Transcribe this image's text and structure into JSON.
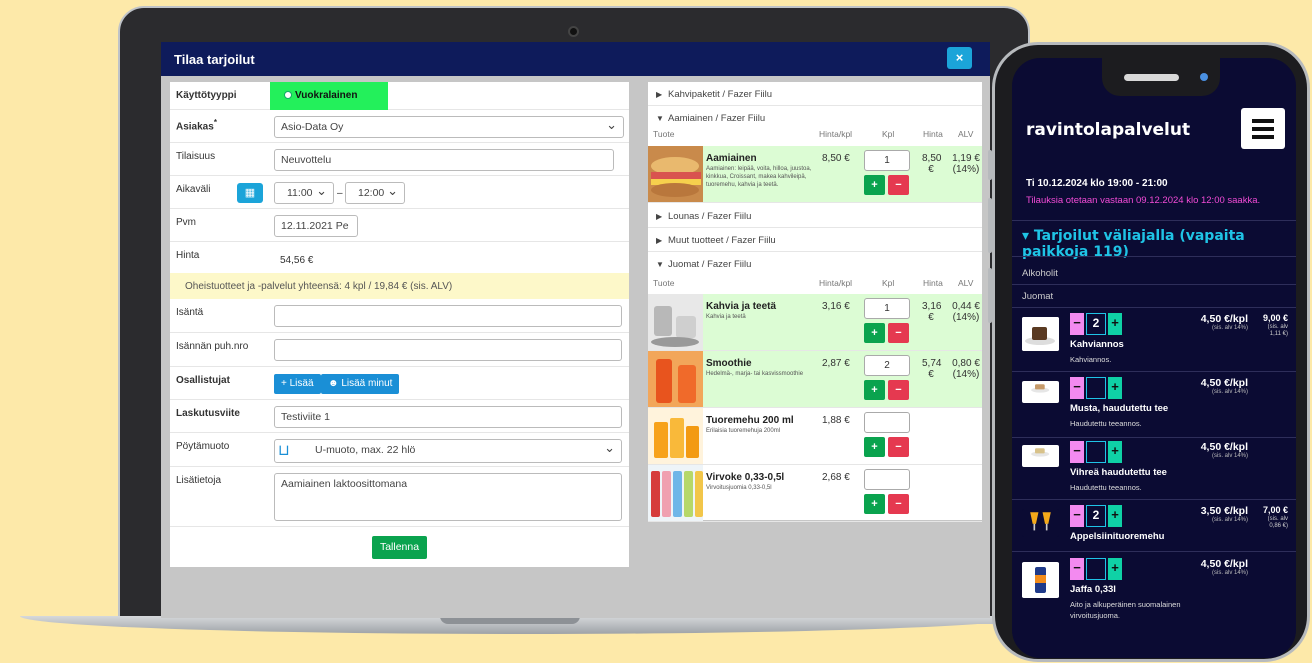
{
  "modal": {
    "title": "Tilaa tarjoilut",
    "close": "×"
  },
  "form": {
    "kayttotyyppi_label": "Käyttötyyppi",
    "kayttotyyppi_value": "Vuokralainen",
    "asiakas_label": "Asiakas",
    "asiakas_required": "*",
    "asiakas_value": "Asio-Data Oy",
    "tilaisuus_label": "Tilaisuus",
    "tilaisuus_value": "Neuvottelu",
    "aikavali_label": "Aikaväli",
    "aikavali_from": "11:00",
    "aikavali_sep": "–",
    "aikavali_to": "12:00",
    "pvm_label": "Pvm",
    "pvm_value": "12.11.2021 Pe",
    "hinta_label": "Hinta",
    "hinta_value": "54,56 €",
    "oheis_info": "Oheistuotteet ja -palvelut yhteensä: 4 kpl / 19,84 € (sis. ALV)",
    "isanta_label": "Isäntä",
    "isanta_value": "",
    "isanta_puh_label": "Isännän puh.nro",
    "isanta_puh_value": "",
    "osallistujat_label": "Osallistujat",
    "lisaa_btn": "Lisää",
    "lisaa_minut_btn": "Lisää minut",
    "laskutusviite_label": "Laskutusviite",
    "laskutusviite_value": "Testiviite 1",
    "poytamuoto_label": "Pöytämuoto",
    "poytamuoto_value": "U-muoto, max. 22 hlö",
    "lisatietoja_label": "Lisätietoja",
    "lisatietoja_value": "Aamiainen laktoosittomana",
    "save_btn": "Tallenna"
  },
  "menu": {
    "headers": {
      "tuote": "Tuote",
      "hinta_kpl": "Hinta/kpl",
      "kpl": "Kpl",
      "hinta": "Hinta",
      "alv": "ALV"
    },
    "categories": {
      "kahvipaketit": "Kahvipaketit / Fazer Fiilu",
      "aamiainen": "Aamiainen / Fazer Fiilu",
      "lounas": "Lounas / Fazer Fiilu",
      "muut": "Muut tuotteet / Fazer Fiilu",
      "juomat": "Juomat / Fazer Fiilu"
    },
    "items": [
      {
        "name": "Aamiainen",
        "desc": "Aamiainen: leipää, voita, hilloa, juustoa, kinkkua, Croissant, makea kahvileipä, tuoremehu, kahvia ja teetä.",
        "price": "8,50 €",
        "qty": "1",
        "total": "8,50 €",
        "alv": "1,19 € (14%)"
      },
      {
        "name": "Kahvia ja teetä",
        "desc": "Kahvia ja teetä",
        "price": "3,16 €",
        "qty": "1",
        "total": "3,16 €",
        "alv": "0,44 € (14%)"
      },
      {
        "name": "Smoothie",
        "desc": "Hedelmä-, marja- tai kasvissmoothie",
        "price": "2,87 €",
        "qty": "2",
        "total": "5,74 €",
        "alv": "0,80 € (14%)"
      },
      {
        "name": "Tuoremehu 200 ml",
        "desc": "Erilaisia tuoremehuja 200ml",
        "price": "1,88 €",
        "qty": "",
        "total": "",
        "alv": ""
      },
      {
        "name": "Virvoke 0,33-0,5l",
        "desc": "Virvoitusjuomia 0,33-0,5l",
        "price": "2,68 €",
        "qty": "",
        "total": "",
        "alv": ""
      }
    ],
    "plus": "+",
    "minus": "−"
  },
  "phone": {
    "title": "ravintolapalvelut",
    "date": "Ti 10.12.2024 klo 19:00 - 21:00",
    "note": "Tilauksia otetaan vastaan 09.12.2024 klo 12:00 saakka.",
    "section": "▾ Tarjoilut väliajalla (vapaita paikkoja 119)",
    "cat_alkoholit": "Alkoholit",
    "cat_juomat": "Juomat",
    "minus": "−",
    "plus": "+",
    "items": [
      {
        "name": "Kahviannos",
        "desc": "Kahviannos.",
        "qty": "2",
        "price": "4,50 €/kpl",
        "alv": "(sis. alv 14%)",
        "total": "9,00 €",
        "total_alv": "(sis. alv 1,11 €)"
      },
      {
        "name": "Musta, haudutettu tee",
        "desc": "Haudutettu teeannos.",
        "qty": "",
        "price": "4,50 €/kpl",
        "alv": "(sis. alv 14%)",
        "total": "",
        "total_alv": ""
      },
      {
        "name": "Vihreä haudutettu tee",
        "desc": "Haudutettu teeannos.",
        "qty": "",
        "price": "4,50 €/kpl",
        "alv": "(sis. alv 14%)",
        "total": "",
        "total_alv": ""
      },
      {
        "name": "Appelsiinituoremehu",
        "desc": "",
        "qty": "2",
        "price": "3,50 €/kpl",
        "alv": "(sis. alv 14%)",
        "total": "7,00 €",
        "total_alv": "(sis. alv 0,86 €)"
      },
      {
        "name": "Jaffa 0,33l",
        "desc": "Aito ja alkuperäinen suomalainen virvoitusjuoma.",
        "qty": "",
        "price": "4,50 €/kpl",
        "alv": "(sis. alv 14%)",
        "total": "",
        "total_alv": ""
      }
    ]
  },
  "colors": {
    "accent": "#1ba4d9",
    "header": "#0e1b5b",
    "green": "#0aa34e",
    "red": "#e53950",
    "phone_bg": "#0b0b33",
    "pink": "#f24bd6",
    "cyan": "#1fc4e6"
  }
}
